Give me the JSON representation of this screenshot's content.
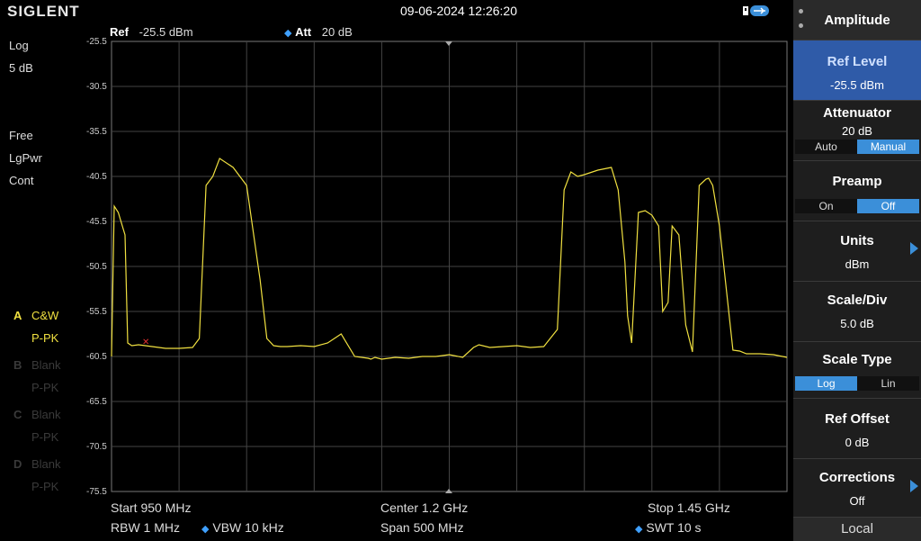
{
  "header": {
    "brand": "SIGLENT",
    "datetime": "09-06-2024 12:26:20"
  },
  "measure_bar": {
    "ref_label": "Ref",
    "ref_value": "-25.5 dBm",
    "att_label": "Att",
    "att_value": "20 dB"
  },
  "left_panel": {
    "scale_type": "Log",
    "scale_div": "5 dB",
    "trigger": "Free",
    "detector": "LgPwr",
    "sweep_mode": "Cont",
    "traces": [
      {
        "letter": "A",
        "mode": "C&W",
        "detector": "P-PK",
        "color": "#f0e040"
      },
      {
        "letter": "B",
        "mode": "Blank",
        "detector": "P-PK",
        "color": "#3a3a3a"
      },
      {
        "letter": "C",
        "mode": "Blank",
        "detector": "P-PK",
        "color": "#3a3a3a"
      },
      {
        "letter": "D",
        "mode": "Blank",
        "detector": "P-PK",
        "color": "#3a3a3a"
      }
    ]
  },
  "y_axis": {
    "ticks": [
      "-25.5",
      "-30.5",
      "-35.5",
      "-40.5",
      "-45.5",
      "-50.5",
      "-55.5",
      "-60.5",
      "-65.5",
      "-70.5",
      "-75.5"
    ]
  },
  "footer": {
    "start": "Start  950 MHz",
    "center": "Center  1.2 GHz",
    "stop": "Stop  1.45 GHz",
    "rbw": "RBW  1 MHz",
    "vbw": "VBW  10 kHz",
    "span": "Span    500 MHz",
    "swt": "SWT  10 s"
  },
  "menu": {
    "title": "Amplitude",
    "items": [
      {
        "label": "Ref Level",
        "value": "-25.5 dBm"
      },
      {
        "label": "Attenuator",
        "value": "20 dB",
        "options": [
          "Auto",
          "Manual"
        ],
        "selected": "Manual"
      },
      {
        "label": "Preamp",
        "options": [
          "On",
          "Off"
        ],
        "selected": "Off"
      },
      {
        "label": "Units",
        "value": "dBm"
      },
      {
        "label": "Scale/Div",
        "value": "5.0 dB"
      },
      {
        "label": "Scale Type",
        "options": [
          "Log",
          "Lin"
        ],
        "selected": "Log"
      },
      {
        "label": "Ref Offset",
        "value": "0 dB"
      },
      {
        "label": "Corrections",
        "value": "Off"
      }
    ],
    "local": "Local"
  },
  "chart_data": {
    "type": "line",
    "xlabel": "",
    "ylabel": "",
    "x_unit": "MHz",
    "xlim": [
      950,
      1450
    ],
    "ylim": [
      -75.5,
      -25.5
    ],
    "trace_color": "#f0e040",
    "series": [
      {
        "x": [
          950,
          952,
          955,
          960,
          962,
          965,
          970,
          980,
          990,
          1000,
          1010,
          1015,
          1020,
          1025,
          1030,
          1040,
          1050,
          1060,
          1065,
          1070,
          1075,
          1080,
          1090,
          1100,
          1110,
          1120,
          1130,
          1140,
          1142,
          1145,
          1150,
          1160,
          1170,
          1180,
          1190,
          1200,
          1210,
          1218,
          1222,
          1230,
          1240,
          1250,
          1260,
          1270,
          1280,
          1285,
          1290,
          1295,
          1300,
          1310,
          1320,
          1325,
          1330,
          1332,
          1335,
          1340,
          1345,
          1350,
          1355,
          1358,
          1362,
          1365,
          1370,
          1375,
          1380,
          1385,
          1390,
          1392,
          1395,
          1400,
          1410,
          1415,
          1420,
          1430,
          1440,
          1450
        ],
        "y": [
          -60.5,
          -43.8,
          -44.5,
          -47.0,
          -59.0,
          -59.3,
          -59.2,
          -59.4,
          -59.6,
          -59.6,
          -59.5,
          -58.5,
          -41.5,
          -40.5,
          -38.5,
          -39.5,
          -41.5,
          -52.0,
          -58.5,
          -59.3,
          -59.4,
          -59.4,
          -59.3,
          -59.4,
          -59.0,
          -58.0,
          -60.5,
          -60.7,
          -60.8,
          -60.6,
          -60.8,
          -60.6,
          -60.7,
          -60.5,
          -60.5,
          -60.3,
          -60.6,
          -59.5,
          -59.2,
          -59.5,
          -59.4,
          -59.3,
          -59.5,
          -59.4,
          -57.5,
          -42.0,
          -40.0,
          -40.5,
          -40.3,
          -39.8,
          -39.5,
          -42.0,
          -50.0,
          -56.0,
          -59.0,
          -44.5,
          -44.3,
          -44.8,
          -46.0,
          -55.5,
          -54.5,
          -46.0,
          -47.0,
          -57.0,
          -60.0,
          -41.5,
          -40.8,
          -40.7,
          -41.5,
          -46.0,
          -59.8,
          -59.9,
          -60.2,
          -60.2,
          -60.3,
          -60.6
        ]
      }
    ]
  }
}
